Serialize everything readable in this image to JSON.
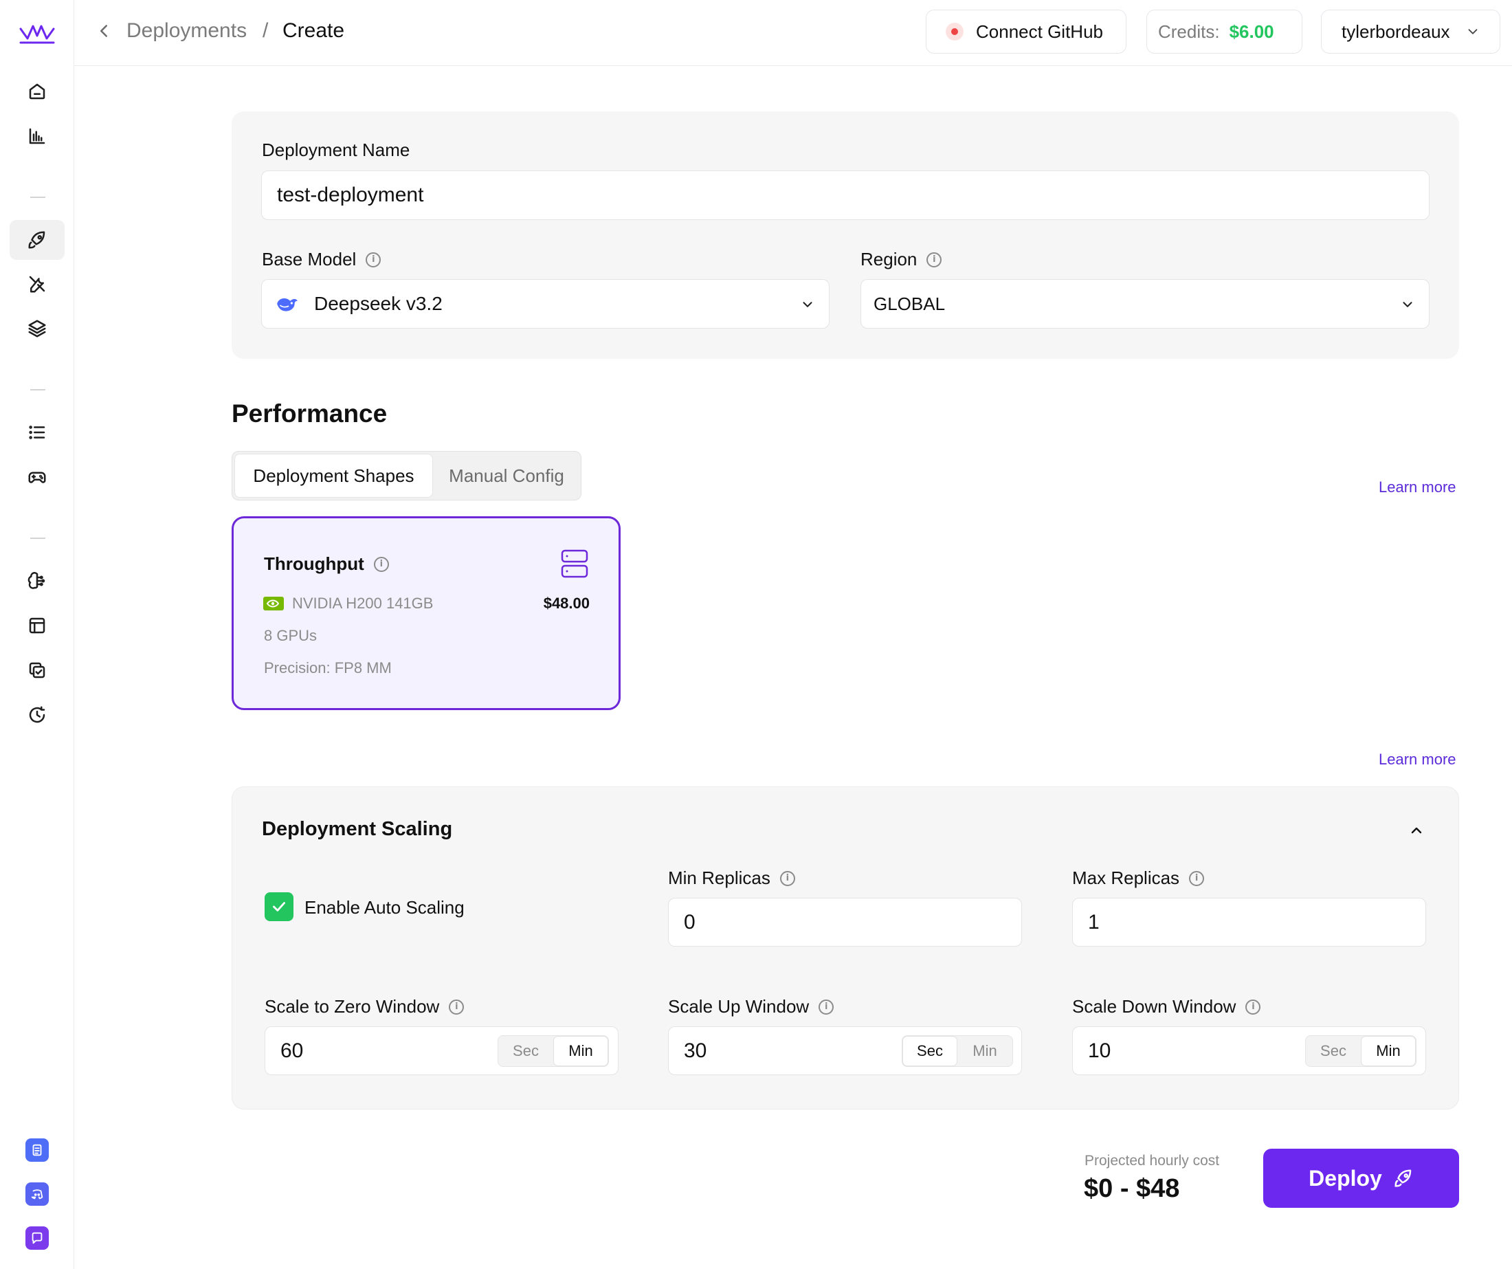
{
  "breadcrumb": {
    "parent": "Deployments",
    "separator": "/",
    "current": "Create"
  },
  "header": {
    "github_label": "Connect GitHub",
    "credits_label": "Credits:",
    "credits_value": "$6.00",
    "user_name": "tylerbordeaux"
  },
  "form": {
    "deployment_name_label": "Deployment Name",
    "deployment_name_value": "test-deployment",
    "base_model_label": "Base Model",
    "base_model_value": "Deepseek v3.2",
    "region_label": "Region",
    "region_value": "GLOBAL"
  },
  "performance": {
    "title": "Performance",
    "tabs": [
      {
        "label": "Deployment Shapes",
        "active": true
      },
      {
        "label": "Manual Config",
        "active": false
      }
    ],
    "learn_more": "Learn more",
    "shape": {
      "title": "Throughput",
      "gpu": "NVIDIA H200 141GB",
      "price": "$48.00",
      "gpu_count": "8 GPUs",
      "precision": "Precision: FP8 MM"
    },
    "learn_more_2": "Learn more"
  },
  "scaling": {
    "title": "Deployment Scaling",
    "auto_scaling_label": "Enable Auto Scaling",
    "auto_scaling_checked": true,
    "min_replicas_label": "Min Replicas",
    "min_replicas_value": "0",
    "max_replicas_label": "Max Replicas",
    "max_replicas_value": "1",
    "scale_zero_label": "Scale to Zero Window",
    "scale_zero_value": "60",
    "scale_zero_unit": "Min",
    "scale_up_label": "Scale Up Window",
    "scale_up_value": "30",
    "scale_up_unit": "Sec",
    "scale_down_label": "Scale Down Window",
    "scale_down_value": "10",
    "scale_down_unit": "Min",
    "unit_sec": "Sec",
    "unit_min": "Min"
  },
  "footer": {
    "projected_label": "Projected hourly cost",
    "projected_value": "$0 - $48",
    "deploy_label": "Deploy"
  },
  "colors": {
    "accent": "#6d28f0",
    "success": "#22c55e",
    "github_dot": "#ef4444"
  },
  "icons": [
    "logo-icon",
    "home-icon",
    "chart-icon",
    "rocket-icon",
    "tools-icon",
    "layers-icon",
    "list-icon",
    "gamepad-icon",
    "brain-icon",
    "table-icon",
    "checklist-icon",
    "history-icon",
    "docs-icon",
    "discord-icon",
    "chat-icon"
  ]
}
